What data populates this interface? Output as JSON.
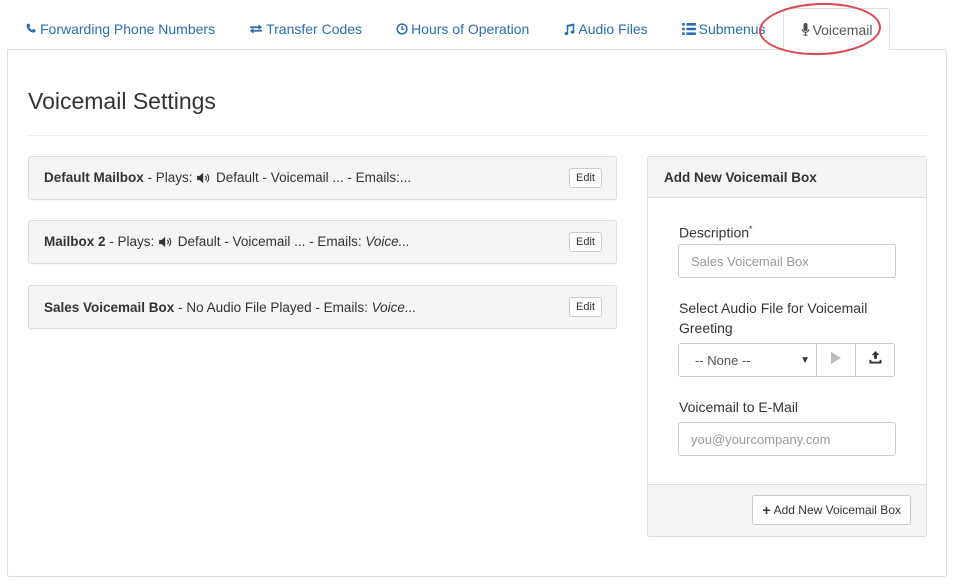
{
  "tabs": [
    {
      "label": "Forwarding Phone Numbers",
      "icon": "phone-icon"
    },
    {
      "label": "Transfer Codes",
      "icon": "exchange-icon"
    },
    {
      "label": "Hours of Operation",
      "icon": "clock-icon"
    },
    {
      "label": "Audio Files",
      "icon": "music-icon"
    },
    {
      "label": "Submenus",
      "icon": "list-icon"
    },
    {
      "label": "Voicemail",
      "icon": "microphone-icon",
      "active": true
    }
  ],
  "page": {
    "title": "Voicemail Settings"
  },
  "mailboxes": [
    {
      "name": "Default Mailbox",
      "plays_prefix": " - Plays: ",
      "plays": " Default - Voicemail ... ",
      "emails_prefix": "- Emails:",
      "emails": "...",
      "edit_label": "Edit"
    },
    {
      "name": "Mailbox 2",
      "plays_prefix": " - Plays: ",
      "plays": " Default - Voicemail ... ",
      "emails_prefix": "- Emails: ",
      "emails": "Voice...",
      "edit_label": "Edit"
    },
    {
      "name": "Sales Voicemail Box",
      "plays_prefix": " - ",
      "plays": "No Audio File Played ",
      "emails_prefix": "- Emails: ",
      "emails": "Voice...",
      "edit_label": "Edit"
    }
  ],
  "add_panel": {
    "title": "Add New Voicemail Box",
    "description_label": "Description",
    "required_mark": "*",
    "description_placeholder": "Sales Voicemail Box",
    "audio_label": "Select Audio File for Voicemail Greeting",
    "audio_selected": "-- None --",
    "email_label": "Voicemail to E-Mail",
    "email_placeholder": "you@yourcompany.com",
    "submit_label": "Add New Voicemail Box"
  },
  "colors": {
    "link": "#2a6db0",
    "highlight": "#e0454f",
    "panel_bg": "#f5f5f5",
    "border": "#dddddd"
  }
}
